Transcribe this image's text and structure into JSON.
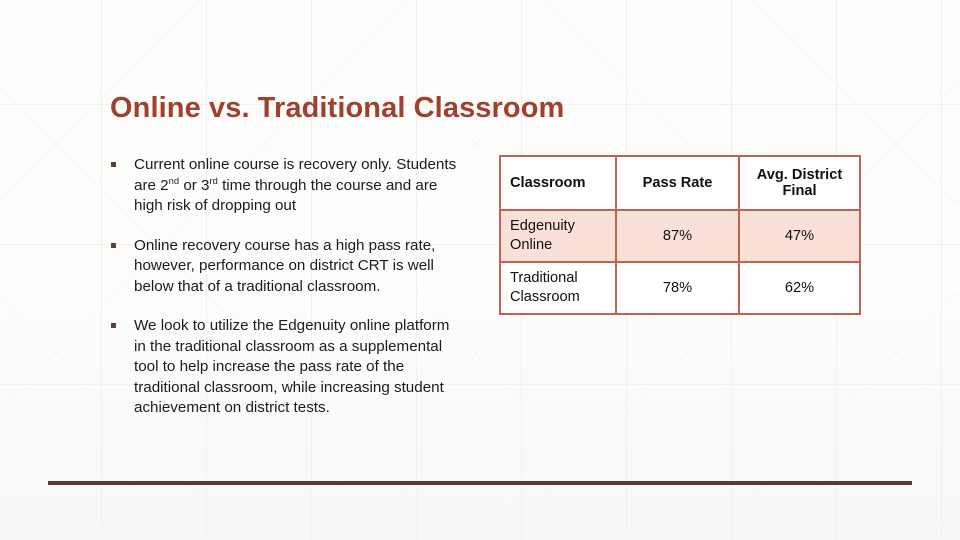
{
  "slide": {
    "title": "Online vs. Traditional Classroom",
    "accent_color": "#a2402e",
    "rule_color": "#5b3a30",
    "table_border_color": "#bf6450",
    "table_row_highlight_color": "#f9e0d8"
  },
  "bullets": [
    {
      "marker": "square-bullet",
      "text_parts": [
        {
          "text": "Current online course is recovery only. Students are 2"
        },
        {
          "text": "nd",
          "superscript": true
        },
        {
          "text": " or 3"
        },
        {
          "text": "rd",
          "superscript": true
        },
        {
          "text": " time through the course and are high risk of dropping out"
        }
      ],
      "plain_text": "Current online course is recovery only. Students are 2nd or 3rd time through the course and are high risk of dropping out"
    },
    {
      "marker": "square-bullet",
      "text_parts": [
        {
          "text": "Online recovery course has a high pass rate, however, performance on district CRT is well below that of a traditional classroom."
        }
      ],
      "plain_text": "Online recovery course has a high pass rate, however, performance on district CRT is well below that of a traditional classroom."
    },
    {
      "marker": "square-bullet",
      "text_parts": [
        {
          "text": "We look to utilize the Edgenuity online platform in the traditional classroom as a supplemental tool to help increase the pass rate of the traditional classroom, while increasing student achievement on district tests."
        }
      ],
      "plain_text": "We look to utilize the Edgenuity online platform in the traditional classroom as a supplemental tool to help increase the pass rate of the traditional classroom, while increasing student achievement on district tests."
    }
  ],
  "table": {
    "headers": [
      "Classroom",
      "Pass Rate",
      "Avg. District Final"
    ],
    "rows": [
      {
        "classroom": "Edgenuity Online",
        "pass_rate": "87%",
        "avg_district_final": "47%",
        "highlighted": true
      },
      {
        "classroom": "Traditional Classroom",
        "pass_rate": "78%",
        "avg_district_final": "62%",
        "highlighted": false
      }
    ]
  },
  "chart_data": {
    "type": "table",
    "title": "Online vs. Traditional Classroom",
    "categories": [
      "Edgenuity Online",
      "Traditional Classroom"
    ],
    "series": [
      {
        "name": "Pass Rate",
        "values": [
          87,
          78
        ],
        "unit": "%"
      },
      {
        "name": "Avg. District Final",
        "values": [
          47,
          62
        ],
        "unit": "%"
      }
    ],
    "xlabel": "Classroom",
    "ylabel": "Percent",
    "ylim": [
      0,
      100
    ],
    "grid": false,
    "legend": "none"
  }
}
